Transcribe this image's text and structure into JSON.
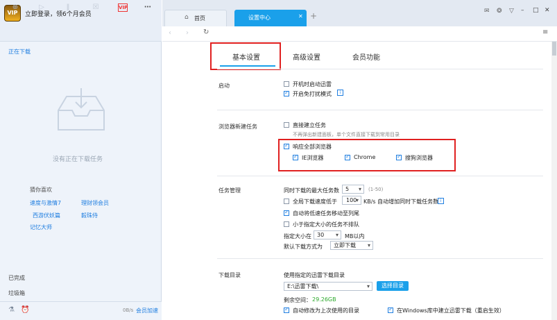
{
  "left": {
    "login": "立即登录，领6个月会员",
    "logo_text": "VIP",
    "downloading": "正在下载",
    "empty_text": "没有正在下载任务",
    "guess_title": "猜你喜欢",
    "recommend": [
      "速度与激情7",
      "理财领会员",
      "西游伏妖篇",
      "毅珠侍",
      "记忆大师"
    ],
    "done": "已完成",
    "trash": "垃圾箱",
    "speed": "0B/s",
    "boost": "会员加速",
    "toolbar_vip": "VIP"
  },
  "tabs": {
    "home": "首页",
    "settings": "设置中心",
    "add": "+"
  },
  "settings_tabs": [
    "基本设置",
    "高级设置",
    "会员功能"
  ],
  "startup": {
    "title": "启动",
    "opt1": "开机时启动迅雷",
    "opt2": "开启免打扰模式"
  },
  "browser": {
    "title": "浏览器新建任务",
    "direct": "直接建立任务",
    "direct_sub": "不再弹出新建面板，单个文件直接下载到常用目录",
    "all": "响应全部浏览器",
    "ie": "IE浏览器",
    "chrome": "Chrome",
    "sogou": "搜狗浏览器"
  },
  "task": {
    "title": "任务管理",
    "max_label": "同时下载的最大任务数",
    "max_value": "5",
    "max_range": "(1-50)",
    "speed_label": "全局下载速度低于",
    "speed_value": "100",
    "speed_suffix": "KB/s 自动增加同时下载任务数",
    "lowspeed": "自动将低速任务移动至列尾",
    "small": "小于指定大小的任务不排队",
    "size_label": "指定大小在",
    "size_value": "30",
    "size_suffix": "MB以内",
    "mode_label": "默认下载方式为",
    "mode_value": "立即下载"
  },
  "dir": {
    "title": "下载目录",
    "use_label": "使用指定的迅雷下载目录",
    "path": "E:\\迅雷下载\\",
    "choose": "选择目录",
    "free_label": "剩余空间：",
    "free_value": "29.26GB",
    "auto_last": "自动修改为上次使用的目录",
    "lib": "在Windows库中建立迅雷下载（重启生效）"
  },
  "colors": {
    "accent": "#1aa0ea",
    "link": "#1f7ee0",
    "highlight": "#e02020",
    "free_space": "#2aa82a"
  }
}
